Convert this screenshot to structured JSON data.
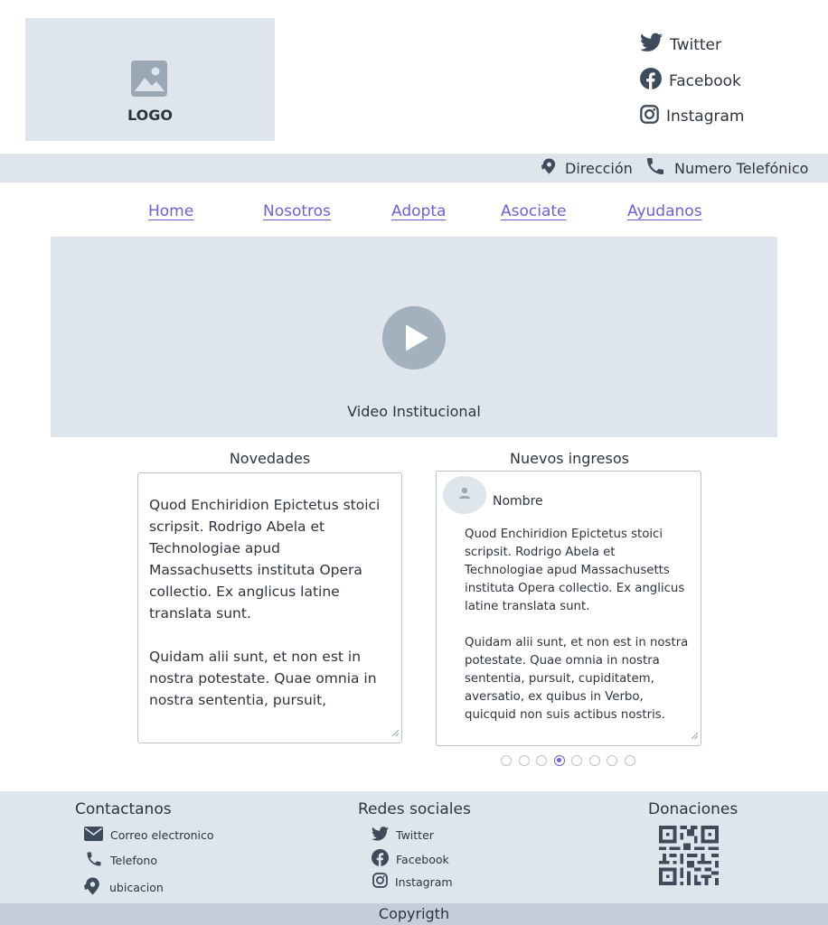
{
  "header": {
    "logo_text": "LOGO",
    "social": [
      {
        "label": "Twitter",
        "icon": "twitter-icon"
      },
      {
        "label": "Facebook",
        "icon": "facebook-icon"
      },
      {
        "label": "Instagram",
        "icon": "instagram-icon"
      }
    ]
  },
  "info_bar": {
    "address": "Dirección",
    "phone": "Numero Telefónico"
  },
  "nav": [
    "Home",
    "Nosotros",
    "Adopta",
    "Asociate",
    "Ayudanos"
  ],
  "video": {
    "caption": "Video Institucional"
  },
  "news": {
    "title": "Novedades",
    "text": "Quod Enchiridion Epictetus stoici scripsit. Rodrigo Abela et Technologiae apud Massachusetts instituta Opera collectio. Ex anglicus latine translata sunt.\n\nQuidam alii sunt, et non est in nostra potestate. Quae omnia in nostra sententia, pursuit,"
  },
  "ingresos": {
    "title": "Nuevos ingresos",
    "name": "Nombre",
    "text": "Quod Enchiridion Epictetus stoici scripsit. Rodrigo Abela et Technologiae apud Massachusetts instituta Opera collectio. Ex anglicus latine translata sunt.\n\nQuidam alii sunt, et non est in nostra potestate. Quae omnia in nostra sententia, pursuit, cupiditatem, aversatio, ex quibus in Verbo, quicquid non suis actibus nostris.",
    "carousel": {
      "count": 8,
      "active_index": 3
    }
  },
  "footer": {
    "contact_title": "Contactanos",
    "contact": [
      {
        "label": "Correo electronico",
        "icon": "mail-icon"
      },
      {
        "label": "Telefono",
        "icon": "phone-icon"
      },
      {
        "label": "ubicacion",
        "icon": "location-icon"
      }
    ],
    "social_title": "Redes sociales",
    "social": [
      {
        "label": "Twitter",
        "icon": "twitter-icon"
      },
      {
        "label": "Facebook",
        "icon": "facebook-icon"
      },
      {
        "label": "Instagram",
        "icon": "instagram-icon"
      }
    ],
    "donations_title": "Donaciones",
    "donations_icon": "qr-code-icon",
    "copyright": "Copyrigth"
  },
  "colors": {
    "placeholder_bg": "#dfe5ed",
    "link": "#6b5fdc",
    "icon": "#3e4b5b",
    "copyright_bg": "#c3ced8"
  }
}
